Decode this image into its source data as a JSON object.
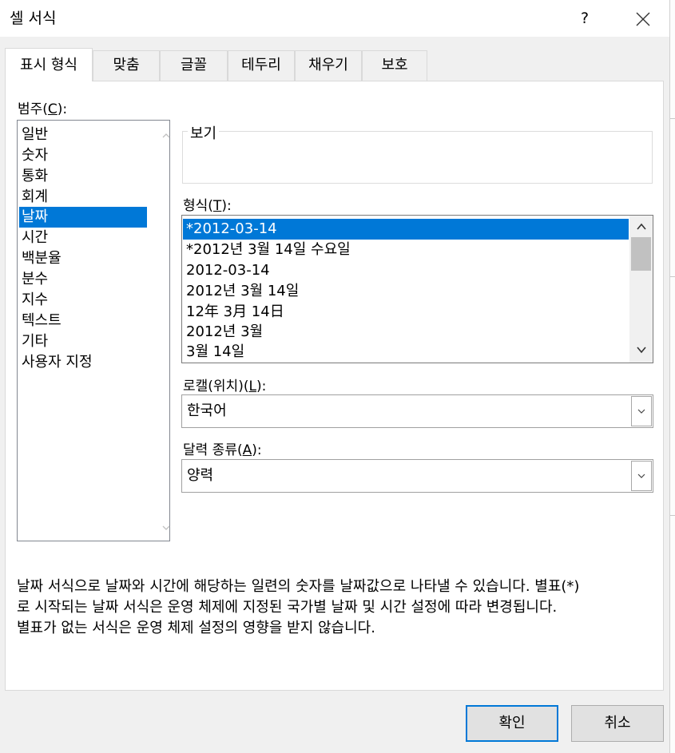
{
  "dialog": {
    "title": "셀 서식",
    "help_label": "?"
  },
  "tabs": [
    {
      "label": "표시 형식"
    },
    {
      "label": "맞춤"
    },
    {
      "label": "글꼴"
    },
    {
      "label": "테두리"
    },
    {
      "label": "채우기"
    },
    {
      "label": "보호"
    }
  ],
  "category": {
    "label_main": "범주(",
    "label_key": "C",
    "label_end": "):",
    "items": [
      "일반",
      "숫자",
      "통화",
      "회계",
      "날짜",
      "시간",
      "백분율",
      "분수",
      "지수",
      "텍스트",
      "기타",
      "사용자 지정"
    ],
    "selected": "날짜"
  },
  "preview": {
    "label": "보기",
    "value": ""
  },
  "format": {
    "label_main": "형식(",
    "label_key": "T",
    "label_end": "):",
    "items": [
      "*2012-03-14",
      "*2012년 3월 14일 수요일",
      "2012-03-14",
      "2012년 3월 14일",
      "12年 3月 14日",
      "2012년 3월",
      "3월 14일"
    ],
    "selected": "*2012-03-14"
  },
  "locale": {
    "label_main": "로캘(위치)(",
    "label_key": "L",
    "label_end": "):",
    "value": "한국어"
  },
  "calendar": {
    "label_main": "달력 종류(",
    "label_key": "A",
    "label_end": "):",
    "value": "양력"
  },
  "description": {
    "line1": "날짜 서식으로 날짜와 시간에 해당하는 일련의 숫자를 날짜값으로 나타낼 수 있습니다. 별표(*)",
    "line2": "로 시작되는 날짜 서식은 운영 체제에 지정된 국가별 날짜 및 시간 설정에 따라 변경됩니다.",
    "line3": "별표가 없는 서식은 운영 체제 설정의 영향을 받지 않습니다."
  },
  "buttons": {
    "ok": "확인",
    "cancel": "취소"
  },
  "colors": {
    "selection": "#0078d7",
    "dialog_bg": "#f0f0f0",
    "panel_bg": "#ffffff"
  }
}
